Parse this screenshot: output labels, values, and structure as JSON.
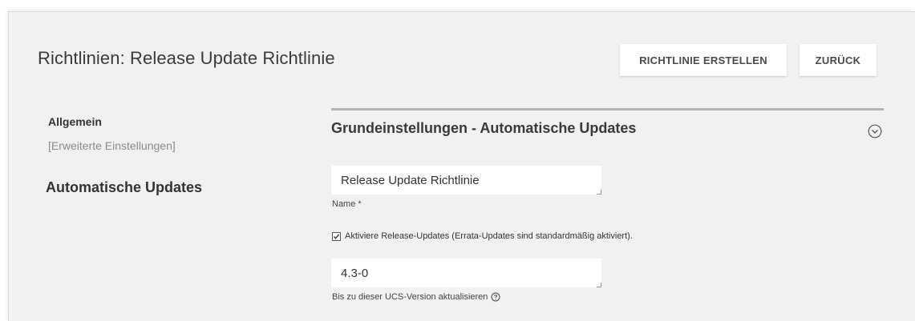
{
  "header": {
    "title": "Richtlinien: Release Update Richtlinie",
    "create_button": "RICHTLINIE ERSTELLEN",
    "back_button": "ZURÜCK"
  },
  "sidebar": {
    "general": "Allgemein",
    "advanced": "[Erweiterte Einstellungen]",
    "section": "Automatische Updates"
  },
  "section": {
    "title": "Grundeinstellungen - Automatische Updates",
    "icon": "chevron-circle-down-icon"
  },
  "form": {
    "name_value": "Release Update Richtlinie",
    "name_label": "Name *",
    "checkbox_checked": true,
    "checkbox_label": "Aktiviere Release-Updates (Errata-Updates sind standardmäßig aktiviert).",
    "version_value": "4.3-0",
    "version_label": "Bis zu dieser UCS-Version aktualisieren",
    "version_help_icon": "question-circle-icon"
  }
}
